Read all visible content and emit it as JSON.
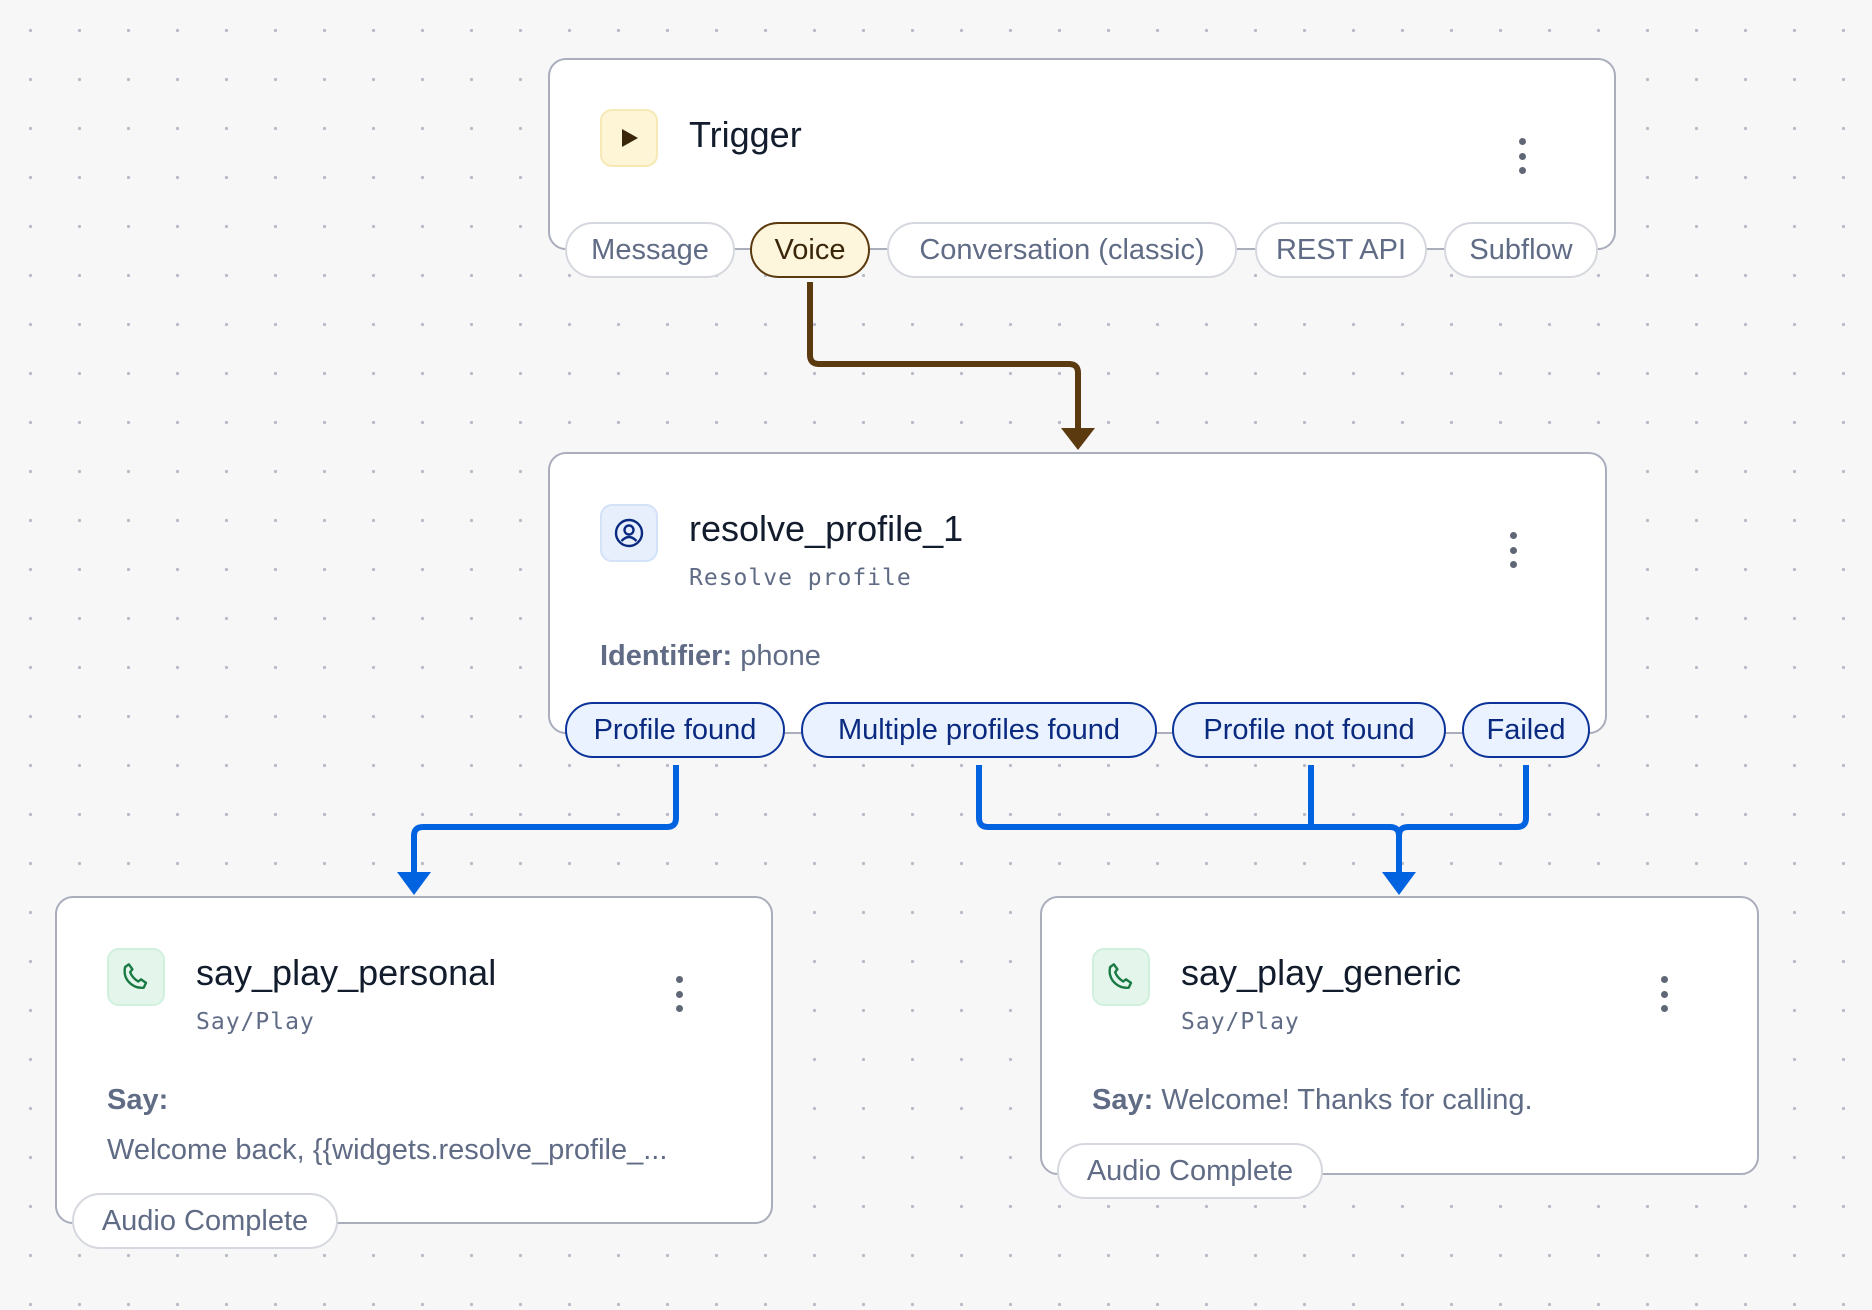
{
  "colors": {
    "voice_wire": "#5c3a10",
    "branch_wire": "#0263e0",
    "node_border": "#a9adbc",
    "port_default_border": "#d5d8de",
    "port_blue_border": "#0c3399",
    "canvas_background": "#f7f7f8"
  },
  "trigger": {
    "title": "Trigger",
    "icon": "play-icon",
    "ports": [
      "Message",
      "Voice",
      "Conversation (classic)",
      "REST API",
      "Subflow"
    ],
    "active_port": "Voice"
  },
  "resolve_profile": {
    "title": "resolve_profile_1",
    "subtitle": "Resolve profile",
    "icon": "user-profile-icon",
    "identifier_label": "Identifier:",
    "identifier_value": "phone",
    "ports": [
      "Profile found",
      "Multiple profiles found",
      "Profile not found",
      "Failed"
    ]
  },
  "say_play_personal": {
    "title": "say_play_personal",
    "subtitle": "Say/Play",
    "icon": "phone-icon",
    "say_label": "Say:",
    "say_value": "Welcome back, {{widgets.resolve_profile_...",
    "port": "Audio Complete"
  },
  "say_play_generic": {
    "title": "say_play_generic",
    "subtitle": "Say/Play",
    "icon": "phone-icon",
    "say_label": "Say:",
    "say_value": "Welcome! Thanks for calling.",
    "port": "Audio Complete"
  }
}
